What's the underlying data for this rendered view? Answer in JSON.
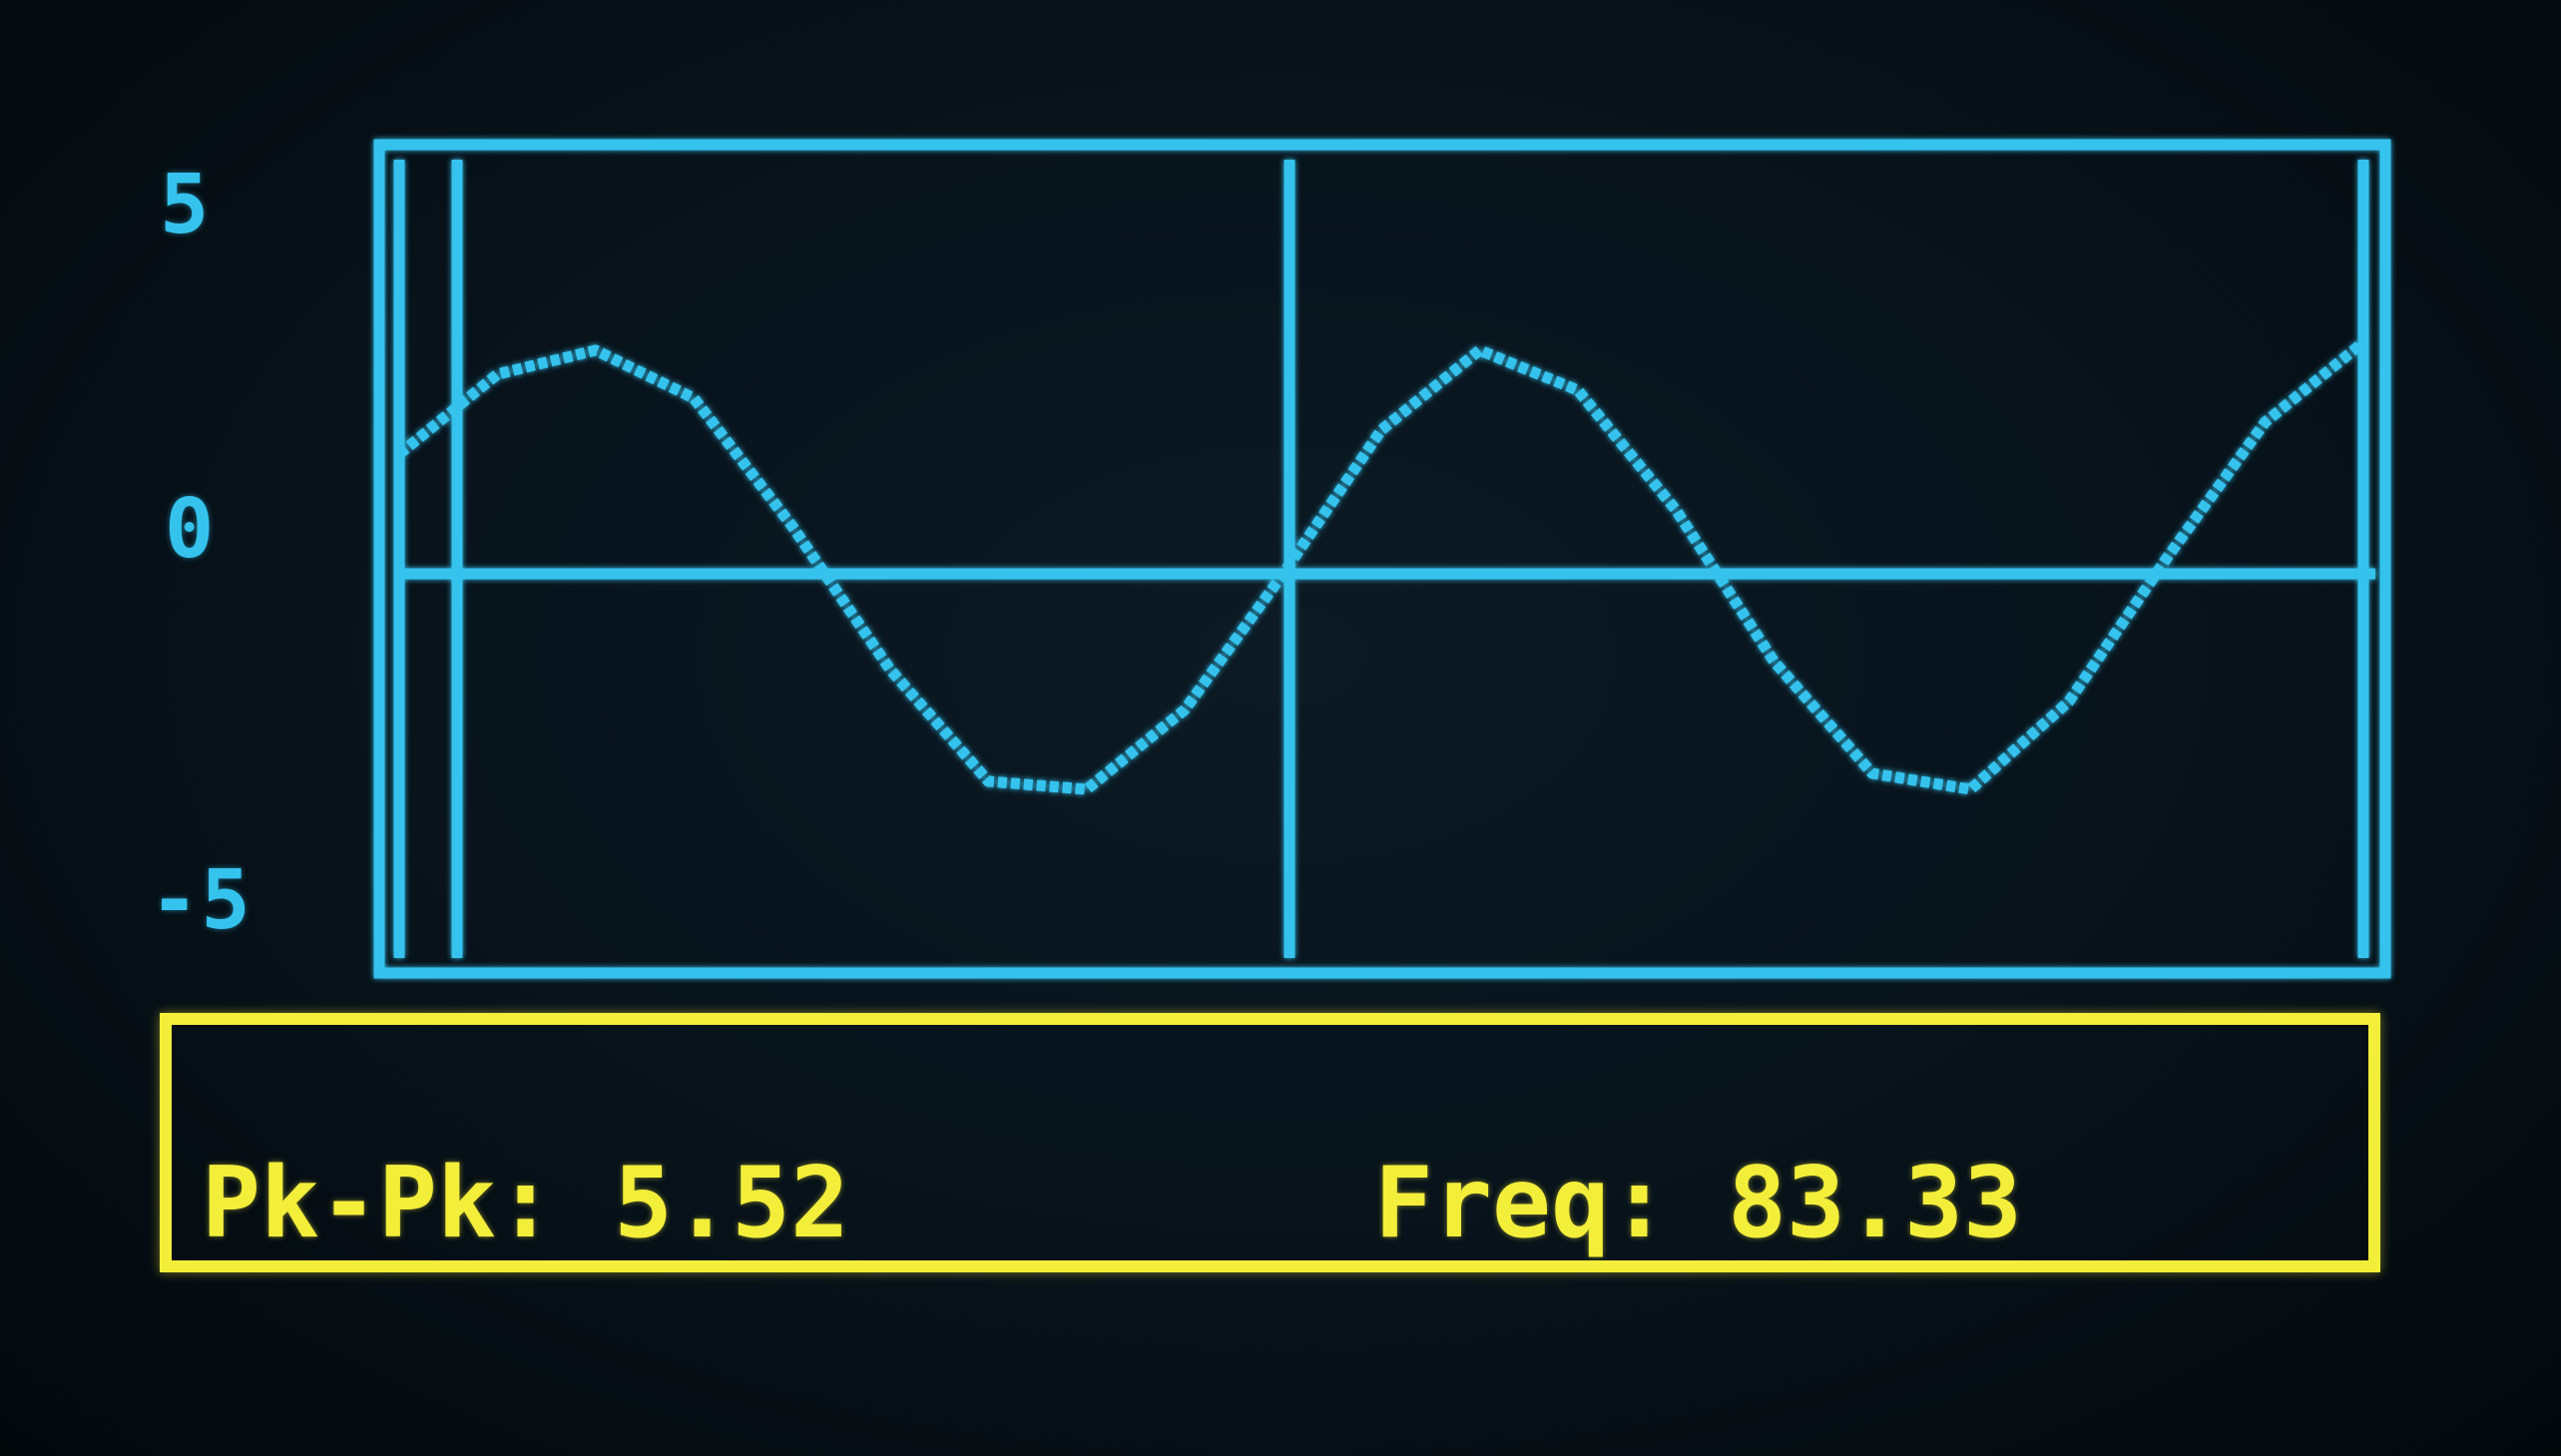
{
  "y_axis": {
    "top_label": "5",
    "middle_label": "0",
    "bottom_label": "-5"
  },
  "readout": {
    "pkpk_label": "Pk-Pk:",
    "pkpk_value": "5.52",
    "freq_label": "Freq:",
    "freq_value": "83.33"
  },
  "colors": {
    "trace": "#35c3ee",
    "readout": "#f3ee3a",
    "background": "#07121a"
  },
  "chart_data": {
    "type": "line",
    "ylim": [
      -5,
      5
    ],
    "series": [
      {
        "x": [
          0,
          0.5,
          1,
          1.5,
          2,
          2.5,
          3,
          3.5,
          4,
          4.5,
          5,
          5.5,
          6,
          6.5,
          7,
          7.5,
          8,
          8.5,
          9,
          9.5,
          10
        ],
        "values": [
          1.5,
          2.5,
          2.8,
          2.2,
          0.6,
          -1.2,
          -2.6,
          -2.7,
          -1.7,
          0.0,
          1.8,
          2.8,
          2.3,
          0.8,
          -1.1,
          -2.5,
          -2.7,
          -1.6,
          0.2,
          1.9,
          2.9
        ]
      }
    ]
  }
}
